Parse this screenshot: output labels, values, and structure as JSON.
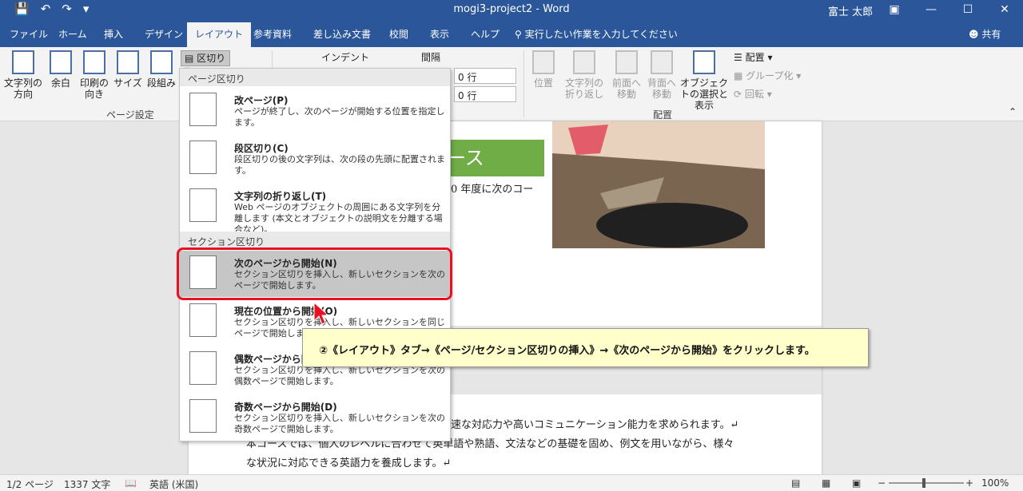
{
  "window": {
    "title": "mogi3-project2  -  Word",
    "user": "富士 太郎"
  },
  "tabs": [
    {
      "label": "ファイル"
    },
    {
      "label": "ホーム"
    },
    {
      "label": "挿入"
    },
    {
      "label": "デザイン"
    },
    {
      "label": "レイアウト",
      "active": true
    },
    {
      "label": "参考資料"
    },
    {
      "label": "差し込み文書"
    },
    {
      "label": "校閲"
    },
    {
      "label": "表示"
    },
    {
      "label": "ヘルプ"
    },
    {
      "label": "実行したい作業を入力してください"
    },
    {
      "label": "共有"
    }
  ],
  "ribbon": {
    "page_setup": {
      "text_direction": "文字列の方向",
      "margins": "余白",
      "orientation": "印刷の向き",
      "size": "サイズ",
      "columns": "段組み",
      "breaks": "区切り",
      "group_label": "ページ設定"
    },
    "paragraph": {
      "indent_label": "インデント",
      "spacing_label": "間隔",
      "spacing_before": "0 行",
      "spacing_after": "0 行"
    },
    "arrange": {
      "position": "位置",
      "wrap_text": "文字列の折り返し",
      "bring_forward": "前面へ移動",
      "send_backward": "背面へ移動",
      "selection_pane": "オブジェクトの選択と表示",
      "align": "配置",
      "group": "グループ化",
      "rotate": "回転",
      "group_label": "配置"
    }
  },
  "breaks_menu": {
    "page_breaks_header": "ページ区切り",
    "section_breaks_header": "セクション区切り",
    "items": [
      {
        "title": "改ページ(P)",
        "desc": "ページが終了し、次のページが開始する位置を指定します。"
      },
      {
        "title": "段区切り(C)",
        "desc": "段区切りの後の文字列は、次の段の先頭に配置されます。"
      },
      {
        "title": "文字列の折り返し(T)",
        "desc": "Web ページのオブジェクトの周囲にある文字列を分離します (本文とオブジェクトの説明文を分離する場合など)。"
      },
      {
        "title": "次のページから開始(N)",
        "desc": "セクション区切りを挿入し、新しいセクションを次のページで開始します。"
      },
      {
        "title": "現在の位置から開始(O)",
        "desc": "セクション区切りを挿入し、新しいセクションを同じページで開始します。"
      },
      {
        "title": "偶数ページから開始(E)",
        "desc": "セクション区切りを挿入し、新しいセクションを次の偶数ページで開始します。"
      },
      {
        "title": "奇数ページから開始(D)",
        "desc": "セクション区切りを挿入し、新しいセクションを次の奇数ページで開始します。"
      }
    ]
  },
  "document": {
    "banner_text": "ース",
    "line1": "0 年度に次のコー",
    "line2": "速な対応力や高いコミュニケーション能力を求められます。↵",
    "line3": "本コースでは、個人のレベルに合わせて英単語や熟語、文法などの基礎を固め、例文を用いながら、様々",
    "line4": "な状況に対応できる英語力を養成します。↵"
  },
  "callout": {
    "text": "②《レイアウト》タブ→《ページ/セクション区切りの挿入》→《次のページから開始》をクリックします。"
  },
  "status": {
    "page": "1/2 ページ",
    "words": "1337 文字",
    "language": "英語 (米国)",
    "zoom": "100%"
  }
}
